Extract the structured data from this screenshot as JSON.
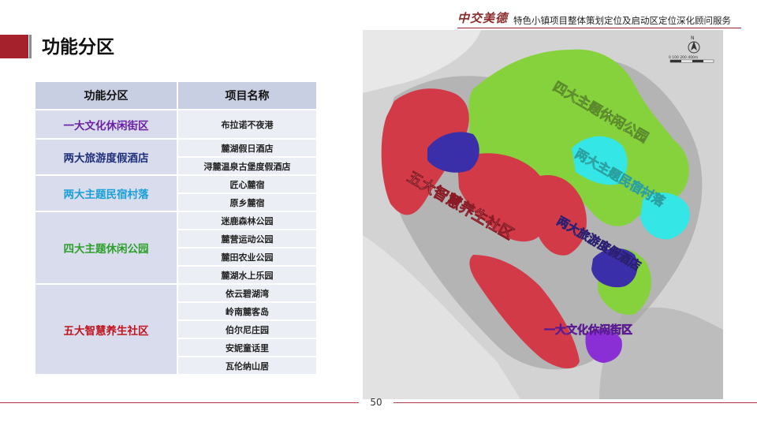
{
  "header": {
    "logo_text": "中交美德",
    "subtitle": "特色小镇项目整体策划定位及启动区定位深化顾问服务"
  },
  "title": "功能分区",
  "table": {
    "headers": [
      "功能分区",
      "项目名称"
    ],
    "groups": [
      {
        "name": "一大文化休闲街区",
        "color": "#6a1fa5",
        "items": [
          "布拉诺不夜港"
        ]
      },
      {
        "name": "两大旅游度假酒店",
        "color": "#1f2f7a",
        "items": [
          "麓湖假日酒店",
          "浔麓温泉古堡度假酒店"
        ]
      },
      {
        "name": "两大主题民宿村落",
        "color": "#1aa0d8",
        "items": [
          "匠心麓宿",
          "原乡麓宿"
        ]
      },
      {
        "name": "四大主题休闲公园",
        "color": "#2ea02a",
        "items": [
          "迷鹿森林公园",
          "麓营运动公园",
          "麓田农业公园",
          "麓湖水上乐园"
        ]
      },
      {
        "name": "五大智慧养生社区",
        "color": "#c0141e",
        "items": [
          "依云碧湖湾",
          "岭南麓客岛",
          "伯尔尼庄园",
          "安妮童话里",
          "瓦伦纳山居"
        ]
      }
    ]
  },
  "map": {
    "labels": [
      {
        "text": "四大主题休闲公园",
        "color": "#8fd14f"
      },
      {
        "text": "两大主题民宿村落",
        "color": "#3fe6e6"
      },
      {
        "text": "五大智慧养生社区",
        "color": "#d93a4a"
      },
      {
        "text": "两大旅游度假酒店",
        "color": "#3a2fa8"
      },
      {
        "text": "一大文化休闲街区",
        "color": "#8a2ed6"
      }
    ],
    "north_label": "N",
    "scale_label": "0  100  200 400m"
  },
  "page_number": "50"
}
